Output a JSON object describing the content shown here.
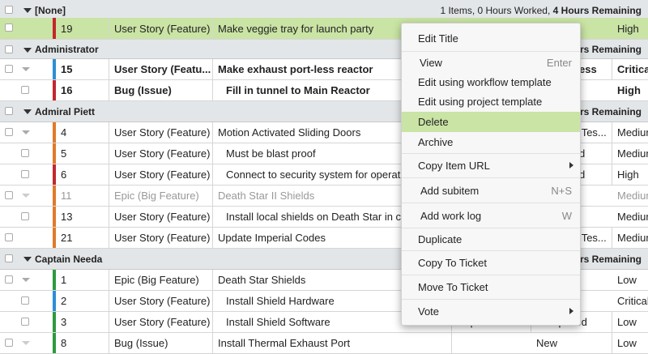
{
  "groups": [
    {
      "name": "[None]",
      "stats_plain": "1 Items, 0 Hours Worked, ",
      "stats_bold": "4 Hours Remaining"
    },
    {
      "name": "Administrator",
      "stats_plain": "",
      "stats_bold": "Hours Remaining"
    },
    {
      "name": "Admiral Piett",
      "stats_plain": "",
      "stats_bold": "Hours Remaining"
    },
    {
      "name": "Captain Needa",
      "stats_plain": "",
      "stats_bold": "Hours Remaining"
    }
  ],
  "rows": [
    {
      "id": "19",
      "type": "User Story (Feature)",
      "title": "Make veggie tray for launch party",
      "c1": "",
      "c2": "",
      "priority": "High",
      "bar": "#c2272d"
    },
    {
      "id": "15",
      "type": "User Story (Featu...",
      "title": "Make exhaust port-less reactor",
      "c1": "",
      "c2": "ess",
      "priority": "Critical",
      "bar": "#2b8fd6"
    },
    {
      "id": "16",
      "type": "Bug (Issue)",
      "title": "Fill in tunnel to Main Reactor",
      "c1": "",
      "c2": "",
      "priority": "High",
      "bar": "#c2272d"
    },
    {
      "id": "4",
      "type": "User Story (Feature)",
      "title": "Motion Activated Sliding Doors",
      "c1": "",
      "c2": "r Tes...",
      "priority": "Medium",
      "bar": "#e07a2a"
    },
    {
      "id": "5",
      "type": "User Story (Feature)",
      "title": "Must be blast proof",
      "c1": "",
      "c2": "d",
      "priority": "Medium",
      "bar": "#e07a2a"
    },
    {
      "id": "6",
      "type": "User Story (Feature)",
      "title": "Connect to security system for operation",
      "c1": "",
      "c2": "d",
      "priority": "High",
      "bar": "#c2272d"
    },
    {
      "id": "11",
      "type": "Epic (Big Feature)",
      "title": "Death Star II Shields",
      "c1": "",
      "c2": "",
      "priority": "Medium",
      "bar": "#e07a2a"
    },
    {
      "id": "13",
      "type": "User Story (Feature)",
      "title": "Install local shields on Death Star in case",
      "c1": "",
      "c2": "",
      "priority": "Medium",
      "bar": "#e07a2a"
    },
    {
      "id": "21",
      "type": "User Story (Feature)",
      "title": "Update Imperial Codes",
      "c1": "",
      "c2": "r Tes...",
      "priority": "Medium",
      "bar": "#e07a2a"
    },
    {
      "id": "1",
      "type": "Epic (Big Feature)",
      "title": "Death Star Shields",
      "c1": "",
      "c2": "",
      "priority": "Low",
      "bar": "#2e9a3e"
    },
    {
      "id": "2",
      "type": "User Story (Feature)",
      "title": "Install Shield Hardware",
      "c1": "",
      "c2": "",
      "priority": "Critical",
      "bar": "#2b8fd6"
    },
    {
      "id": "3",
      "type": "User Story (Feature)",
      "title": "Install Shield Software",
      "c1": "Captain Needa",
      "c2": "Completed",
      "priority": "Low",
      "bar": "#2e9a3e"
    },
    {
      "id": "8",
      "type": "Bug (Issue)",
      "title": "Install Thermal Exhaust Port",
      "c1": "",
      "c2": "New",
      "priority": "Low",
      "bar": "#2e9a3e"
    }
  ],
  "menu": {
    "edit_title": "Edit Title",
    "view": "View",
    "view_shortcut": "Enter",
    "edit_workflow": "Edit using workflow template",
    "edit_project": "Edit using project template",
    "delete": "Delete",
    "archive": "Archive",
    "copy_url": "Copy Item URL",
    "add_subitem": "Add subitem",
    "add_subitem_shortcut": "N+S",
    "add_work_log": "Add work log",
    "add_work_log_shortcut": "W",
    "duplicate": "Duplicate",
    "copy_to_ticket": "Copy To Ticket",
    "move_to_ticket": "Move To Ticket",
    "vote": "Vote"
  },
  "colors": {
    "selected": "#c9e4a4",
    "group_bg": "#e3e6e8"
  }
}
